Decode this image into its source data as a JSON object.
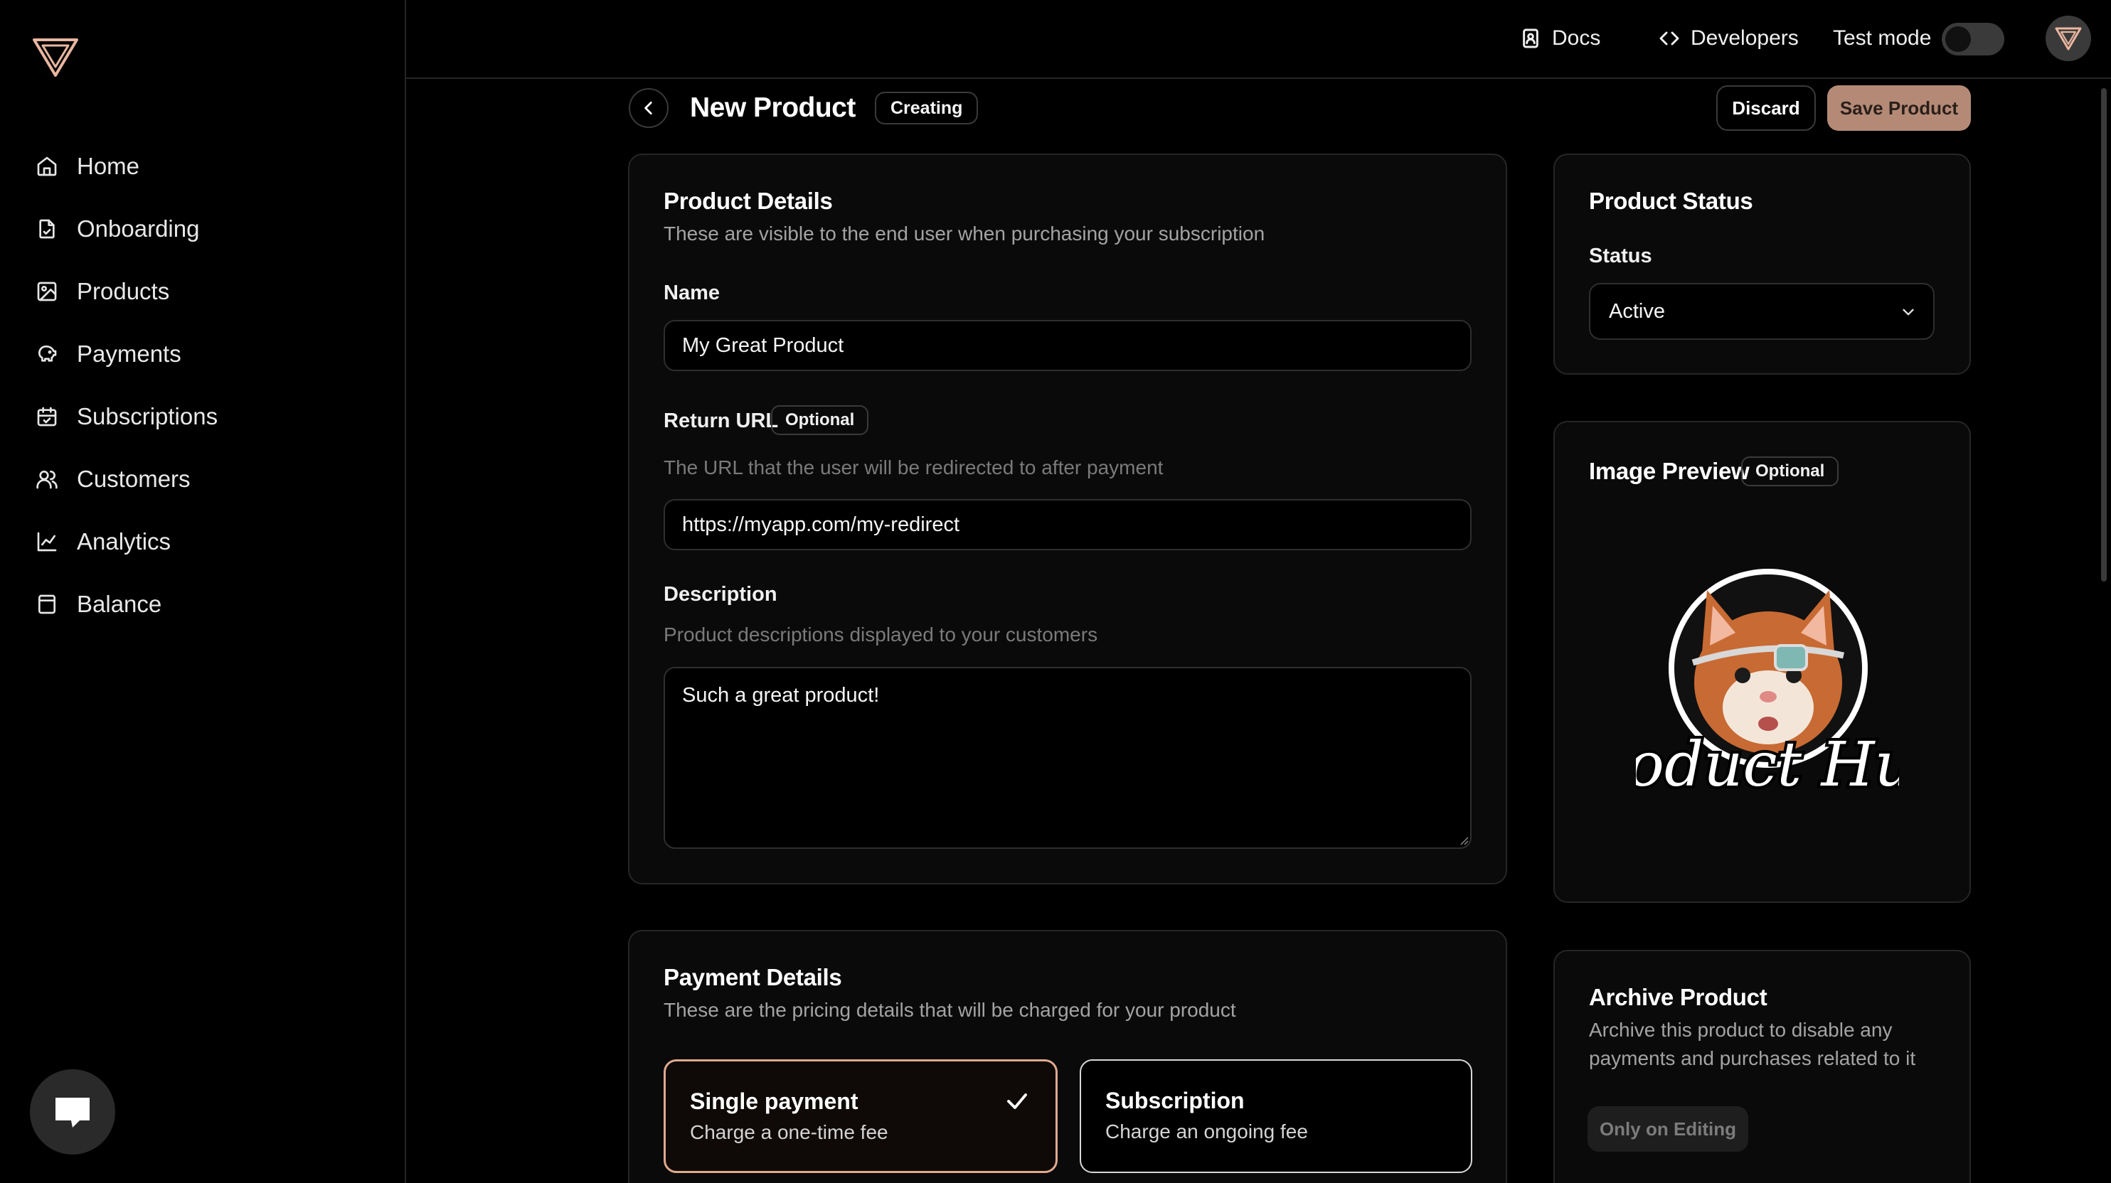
{
  "sidebar": {
    "items": [
      {
        "label": "Home",
        "icon": "home-icon"
      },
      {
        "label": "Onboarding",
        "icon": "file-icon"
      },
      {
        "label": "Products",
        "icon": "image-icon"
      },
      {
        "label": "Payments",
        "icon": "piggy-bank-icon"
      },
      {
        "label": "Subscriptions",
        "icon": "calendar-icon"
      },
      {
        "label": "Customers",
        "icon": "users-icon"
      },
      {
        "label": "Analytics",
        "icon": "chart-icon"
      },
      {
        "label": "Balance",
        "icon": "wallet-icon"
      }
    ]
  },
  "topbar": {
    "docs_label": "Docs",
    "developers_label": "Developers",
    "test_mode_label": "Test mode",
    "test_mode_on": false
  },
  "header": {
    "title": "New Product",
    "status_badge": "Creating",
    "discard_label": "Discard",
    "save_label": "Save Product"
  },
  "product_details": {
    "title": "Product Details",
    "subtitle": "These are visible to the end user when purchasing your subscription",
    "name_label": "Name",
    "name_value": "My Great Product",
    "return_url_label": "Return URL",
    "return_url_badge": "Optional",
    "return_url_hint": "The URL that the user will be redirected to after payment",
    "return_url_value": "https://myapp.com/my-redirect",
    "description_label": "Description",
    "description_hint": "Product descriptions displayed to your customers",
    "description_value": "Such a great product!"
  },
  "payment_details": {
    "title": "Payment Details",
    "subtitle": "These are the pricing details that will be charged for your product",
    "options": [
      {
        "title": "Single payment",
        "subtitle": "Charge a one-time fee",
        "selected": true
      },
      {
        "title": "Subscription",
        "subtitle": "Charge an ongoing fee",
        "selected": false
      }
    ]
  },
  "product_status": {
    "title": "Product Status",
    "status_label": "Status",
    "status_value": "Active"
  },
  "image_preview": {
    "title": "Image Preview",
    "badge": "Optional",
    "image_text": "Product Hunt"
  },
  "archive": {
    "title": "Archive Product",
    "description_line1": "Archive this product to disable any",
    "description_line2": "payments and purchases related to it",
    "button_label": "Only on Editing"
  },
  "colors": {
    "accent": "#b48a76",
    "selected_border": "#e0a98e",
    "background": "#000000",
    "card": "#0a0a0a"
  }
}
